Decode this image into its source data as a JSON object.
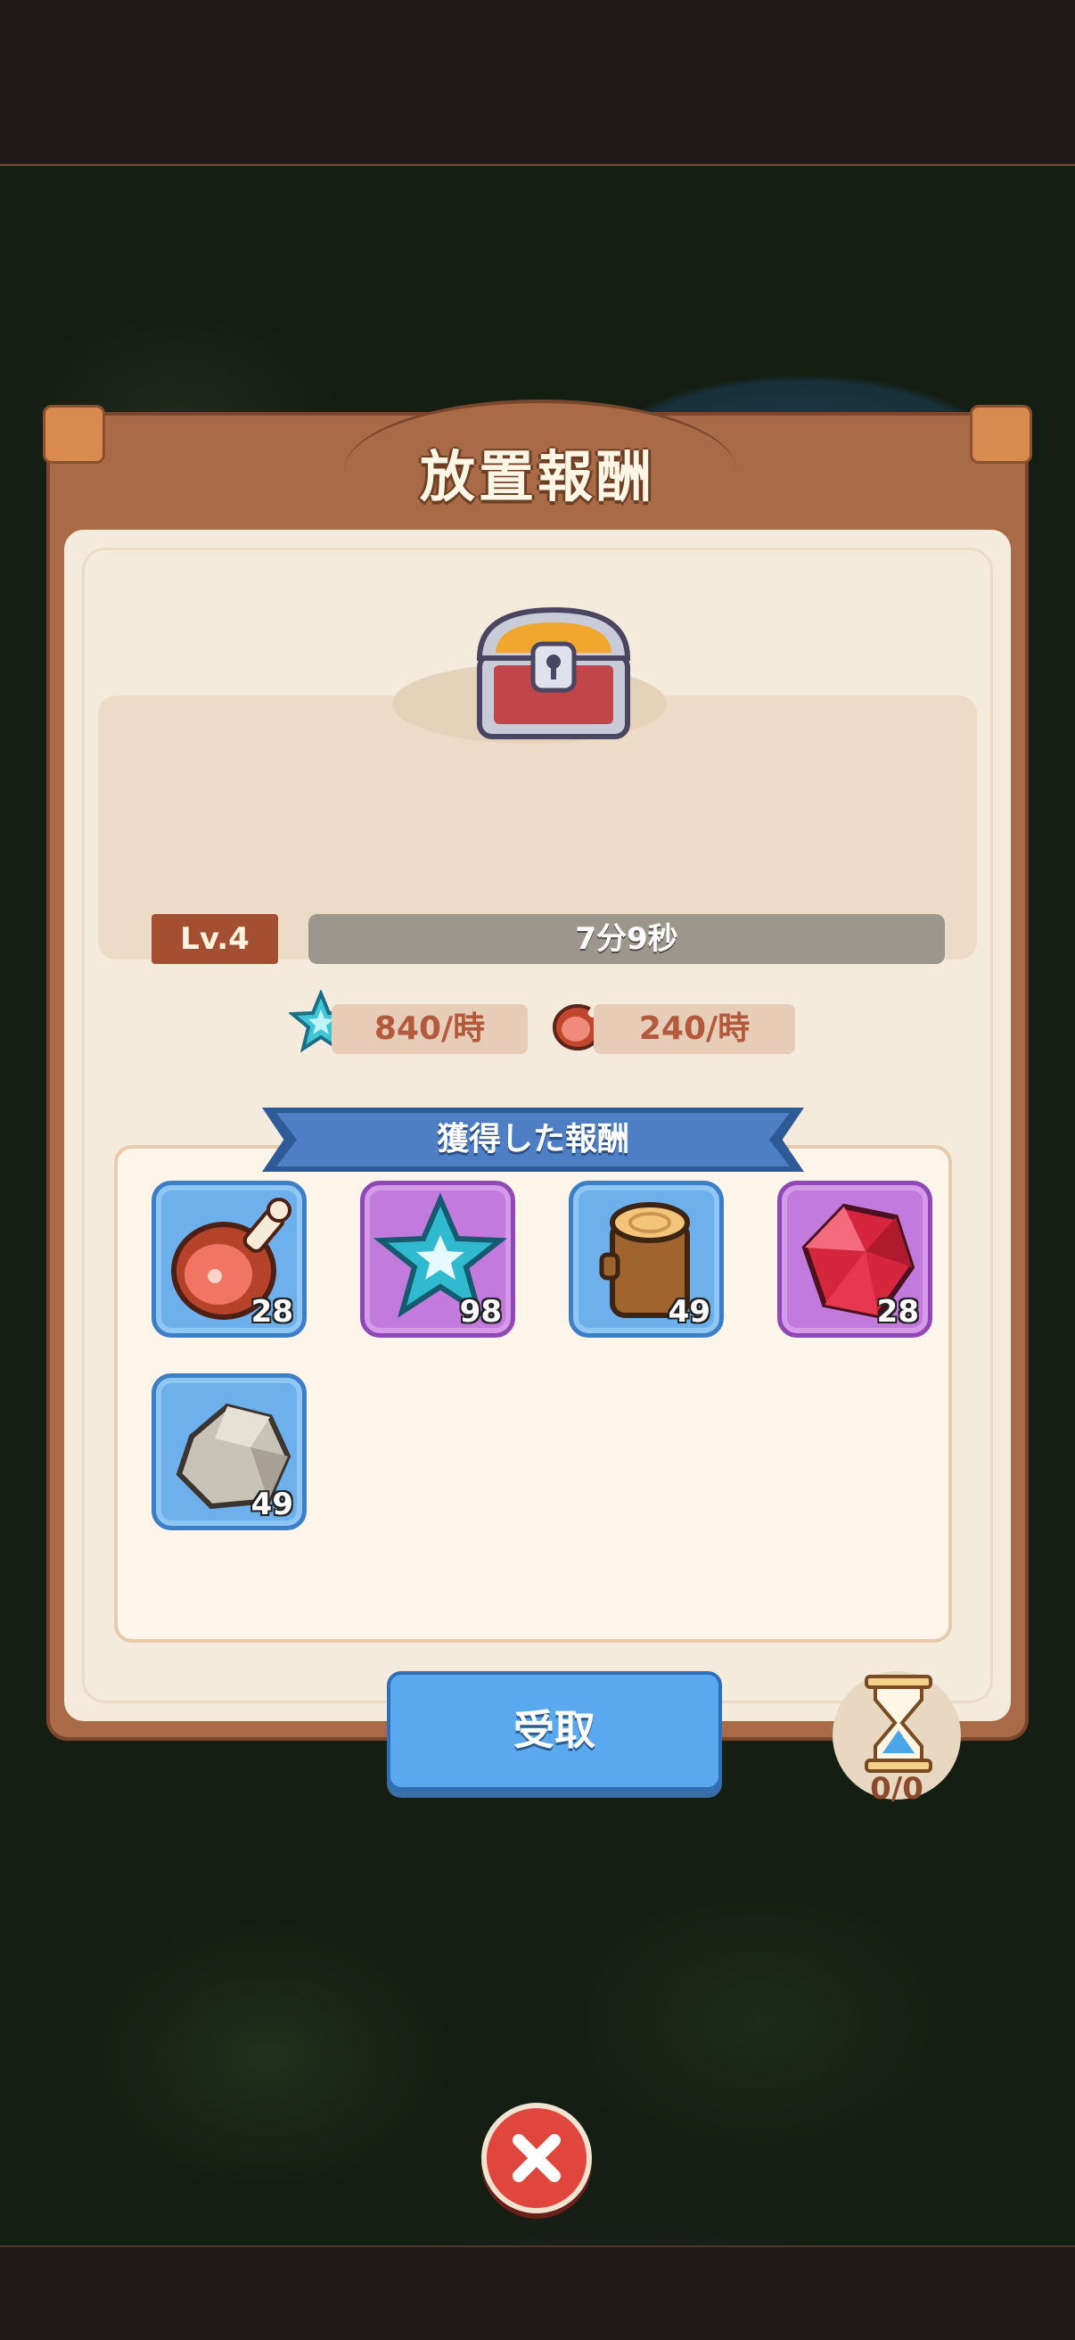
{
  "dialog": {
    "title": "放置報酬",
    "level": "Lv.4",
    "timer": "7分9秒",
    "rates": [
      {
        "icon": "star-icon",
        "value": "840/時"
      },
      {
        "icon": "meat-icon",
        "value": "240/時"
      }
    ],
    "rewards_header": "獲得した報酬",
    "rewards": [
      {
        "icon": "meat-icon",
        "count": "28",
        "rarity": "blue"
      },
      {
        "icon": "star-icon",
        "count": "98",
        "rarity": "purple"
      },
      {
        "icon": "wood-log-icon",
        "count": "49",
        "rarity": "blue"
      },
      {
        "icon": "ruby-gem-icon",
        "count": "28",
        "rarity": "purple"
      },
      {
        "icon": "stone-icon",
        "count": "49",
        "rarity": "blue"
      }
    ],
    "claim_label": "受取",
    "hourglass_count": "0/0"
  },
  "colors": {
    "panel_brown": "#a86a47",
    "cream": "#f4ebdc",
    "button_blue": "#5aa9ef",
    "ribbon_blue": "#4e7fc4",
    "close_red": "#e0463d"
  }
}
